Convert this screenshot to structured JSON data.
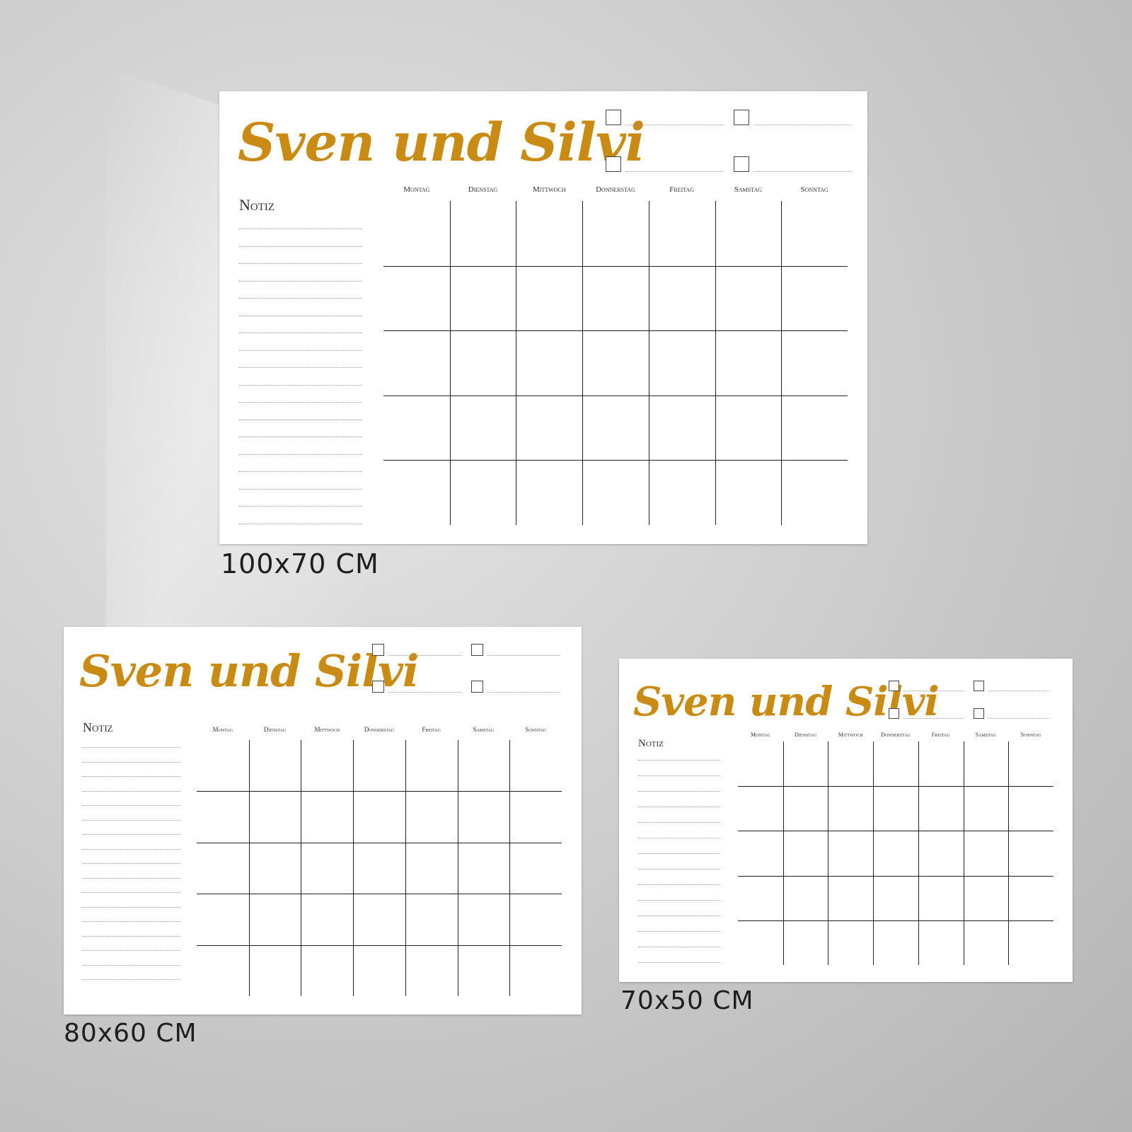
{
  "planner_title": "Sven und Silvi",
  "notiz_label": "Notiz",
  "days": [
    "Montag",
    "Dienstag",
    "Mittwoch",
    "Donnerstag",
    "Freitag",
    "Samstag",
    "Sonntag"
  ],
  "accent_color": "#c98b14",
  "sizes": {
    "large": "100x70 CM",
    "medium": "80x60 CM",
    "small": "70x50 CM"
  }
}
